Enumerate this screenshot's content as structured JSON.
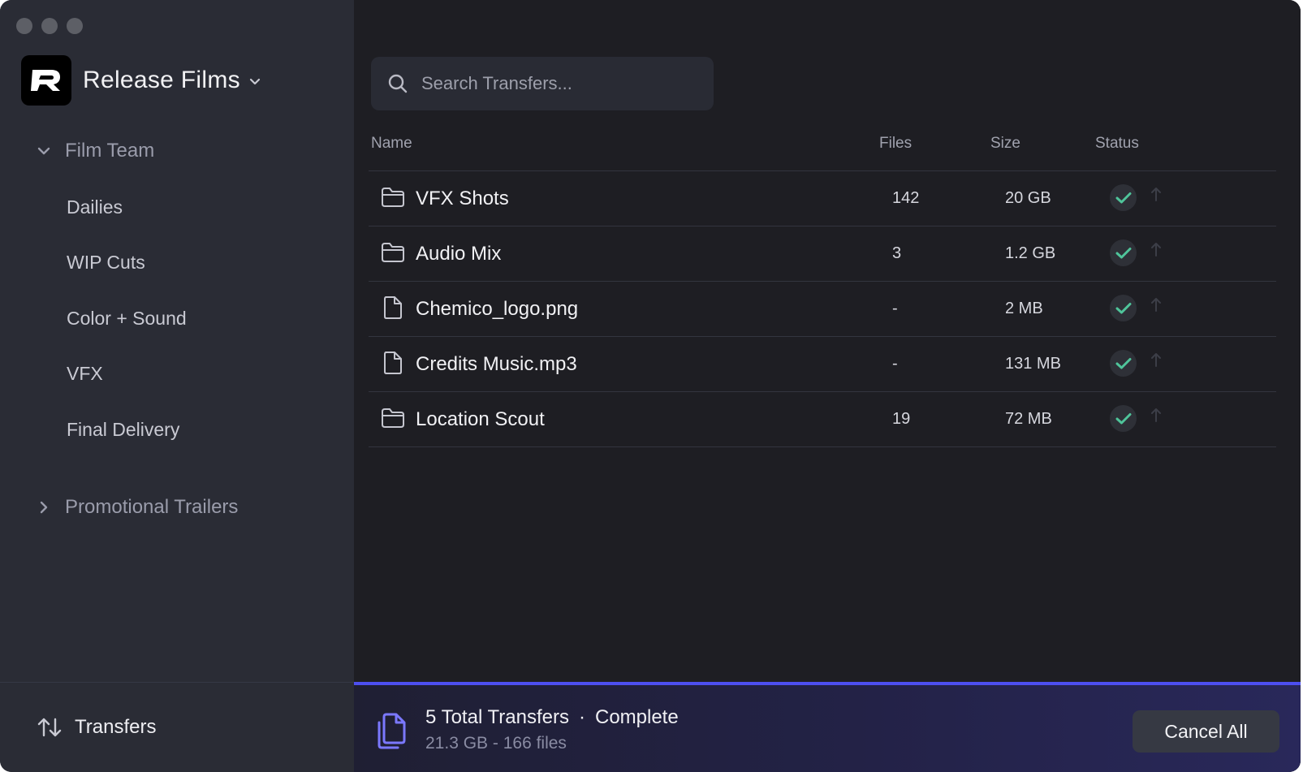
{
  "workspace": {
    "name": "Release Films",
    "logo_letter": "R"
  },
  "sidebar": {
    "sections": [
      {
        "label": "Film Team",
        "expanded": true,
        "items": [
          "Dailies",
          "WIP Cuts",
          "Color + Sound",
          "VFX",
          "Final Delivery"
        ]
      },
      {
        "label": "Promotional Trailers",
        "expanded": false,
        "items": []
      }
    ],
    "footer_label": "Transfers"
  },
  "search": {
    "placeholder": "Search Transfers..."
  },
  "table": {
    "columns": [
      "Name",
      "Files",
      "Size",
      "Status"
    ],
    "rows": [
      {
        "type": "folder",
        "name": "VFX Shots",
        "files": "142",
        "size": "20 GB",
        "status": "complete"
      },
      {
        "type": "folder",
        "name": "Audio Mix",
        "files": "3",
        "size": "1.2 GB",
        "status": "complete"
      },
      {
        "type": "file",
        "name": "Chemico_logo.png",
        "files": "-",
        "size": "2 MB",
        "status": "complete"
      },
      {
        "type": "file",
        "name": "Credits Music.mp3",
        "files": "-",
        "size": "131 MB",
        "status": "complete"
      },
      {
        "type": "folder",
        "name": "Location Scout",
        "files": "19",
        "size": "72 MB",
        "status": "complete"
      }
    ]
  },
  "footer": {
    "title": "5 Total Transfers",
    "separator": "·",
    "state": "Complete",
    "summary": "21.3 GB - 166 files",
    "cancel_label": "Cancel All",
    "progress": 1.0
  },
  "colors": {
    "accent": "#4d4ff0",
    "check": "#4fc49a",
    "sidebar_bg": "#2a2c35",
    "main_bg": "#1e1e23"
  }
}
